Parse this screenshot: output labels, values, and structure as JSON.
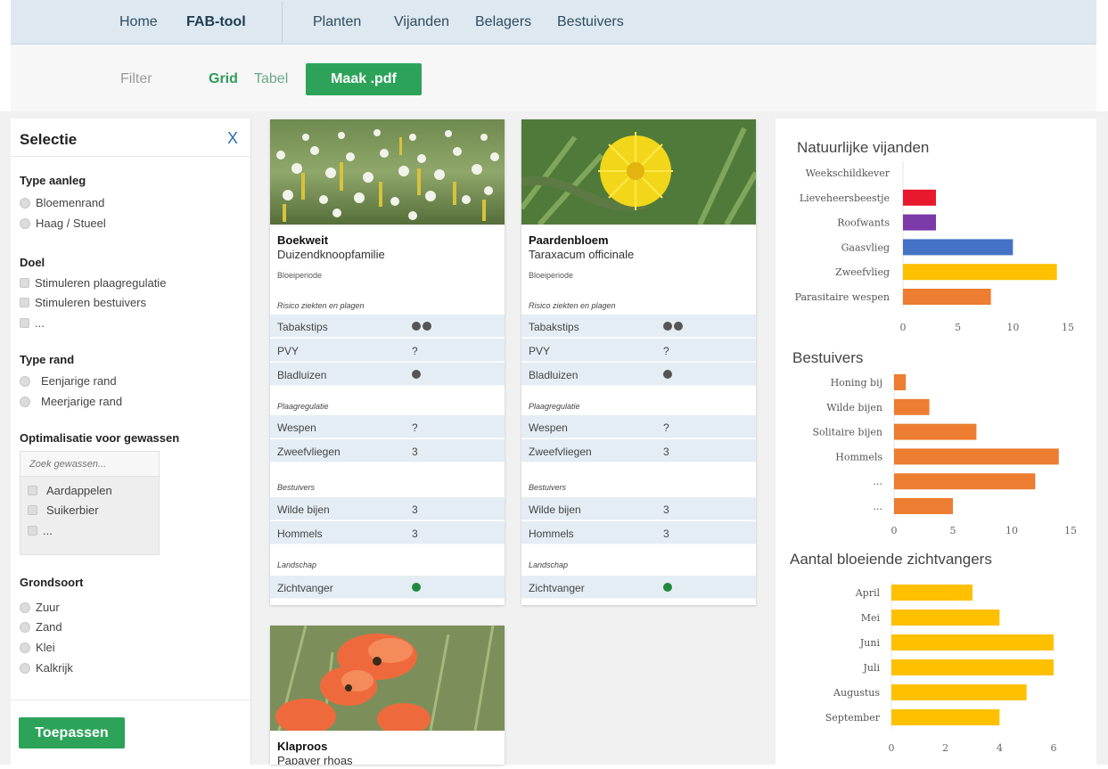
{
  "nav": {
    "home": "Home",
    "brand": "FAB-tool",
    "planten": "Planten",
    "vijanden": "Vijanden",
    "belagers": "Belagers",
    "bestuivers": "Bestuivers"
  },
  "toolbar": {
    "filter": "Filter",
    "grid": "Grid",
    "tabel": "Tabel",
    "pdf": "Maak .pdf"
  },
  "sidebar": {
    "title": "Selectie",
    "close": "X",
    "type_aanleg": {
      "title": "Type aanleg",
      "options": [
        "Bloemenrand",
        "Haag / Stueel"
      ]
    },
    "doel": {
      "title": "Doel",
      "options": [
        "Stimuleren plaagregulatie",
        "Stimuleren bestuivers",
        "..."
      ]
    },
    "type_rand": {
      "title": "Type rand",
      "options": [
        "Eenjarige rand",
        "Meerjarige rand"
      ]
    },
    "gewassen": {
      "title": "Optimalisatie voor gewassen",
      "placeholder": "Zoek gewassen...",
      "options": [
        "Aardappelen",
        "Suikerbier",
        "..."
      ]
    },
    "grondsoort": {
      "title": "Grondsoort",
      "options": [
        "Zuur",
        "Zand",
        "Klei",
        "Kalkrijk"
      ]
    },
    "apply": "Toepassen"
  },
  "cards": [
    {
      "name": "Boekweit",
      "family": "Duizendknoopfamilie",
      "bloeiperiode": "Bloeiperiode",
      "groups": {
        "risico": "Risico ziekten en plagen",
        "plaag": "Plaagregulatie",
        "bestuivers": "Bestuivers",
        "landschap": "Landschap"
      },
      "rows": {
        "tabakstips": "Tabakstips",
        "pvy": "PVY",
        "pvy_val": "?",
        "bladluizen": "Bladluizen",
        "wespen": "Wespen",
        "wespen_val": "?",
        "zweefvliegen": "Zweefvliegen",
        "zweefvliegen_val": "3",
        "wilde_bijen": "Wilde bijen",
        "wilde_bijen_val": "3",
        "hommels": "Hommels",
        "hommels_val": "3",
        "zichtvanger": "Zichtvanger"
      }
    },
    {
      "name": "Paardenbloem",
      "family": "Taraxacum officinale",
      "bloeiperiode": "Bloeiperiode",
      "groups": {
        "risico": "Risico ziekten en plagen",
        "plaag": "Plaagregulatie",
        "bestuivers": "Bestuivers",
        "landschap": "Landschap"
      },
      "rows": {
        "tabakstips": "Tabakstips",
        "pvy": "PVY",
        "pvy_val": "?",
        "bladluizen": "Bladluizen",
        "wespen": "Wespen",
        "wespen_val": "?",
        "zweefvliegen": "Zweefvliegen",
        "zweefvliegen_val": "3",
        "wilde_bijen": "Wilde bijen",
        "wilde_bijen_val": "3",
        "hommels": "Hommels",
        "hommels_val": "3",
        "zichtvanger": "Zichtvanger"
      }
    },
    {
      "name": "Klaproos",
      "family": "Papaver rhoas"
    }
  ],
  "chart_data": [
    {
      "type": "bar",
      "orientation": "horizontal",
      "title": "Natuurlijke vijanden",
      "categories": [
        "Weekschildkever",
        "Lieveheersbeestje",
        "Roofwants",
        "Gaasvlieg",
        "Zweefvlieg",
        "Parasitaire wespen"
      ],
      "values": [
        0,
        3,
        3,
        10,
        14,
        8
      ],
      "colors": [
        "#ffffff",
        "#e8192c",
        "#7b3aa8",
        "#4472c4",
        "#ffc000",
        "#ed7d31"
      ],
      "xticks": [
        "0",
        "5",
        "10",
        "15"
      ],
      "xlim": [
        0,
        15
      ]
    },
    {
      "type": "bar",
      "orientation": "horizontal",
      "title": "Bestuivers",
      "categories": [
        "Honing bij",
        "Wilde bijen",
        "Solitaire bijen",
        "Hommels",
        "...",
        "..."
      ],
      "values": [
        1,
        3,
        7,
        14,
        12,
        5
      ],
      "color": "#ed7d31",
      "xticks": [
        "0",
        "5",
        "10",
        "15"
      ],
      "xlim": [
        0,
        15
      ]
    },
    {
      "type": "bar",
      "orientation": "horizontal",
      "title": "Aantal bloeiende zichtvangers",
      "categories": [
        "April",
        "Mei",
        "Juni",
        "Juli",
        "Augustus",
        "September"
      ],
      "values": [
        3,
        4,
        6,
        6,
        5,
        4
      ],
      "color": "#ffc000",
      "xticks": [
        "0",
        "2",
        "4",
        "6"
      ],
      "xlim": [
        0,
        6
      ]
    }
  ]
}
